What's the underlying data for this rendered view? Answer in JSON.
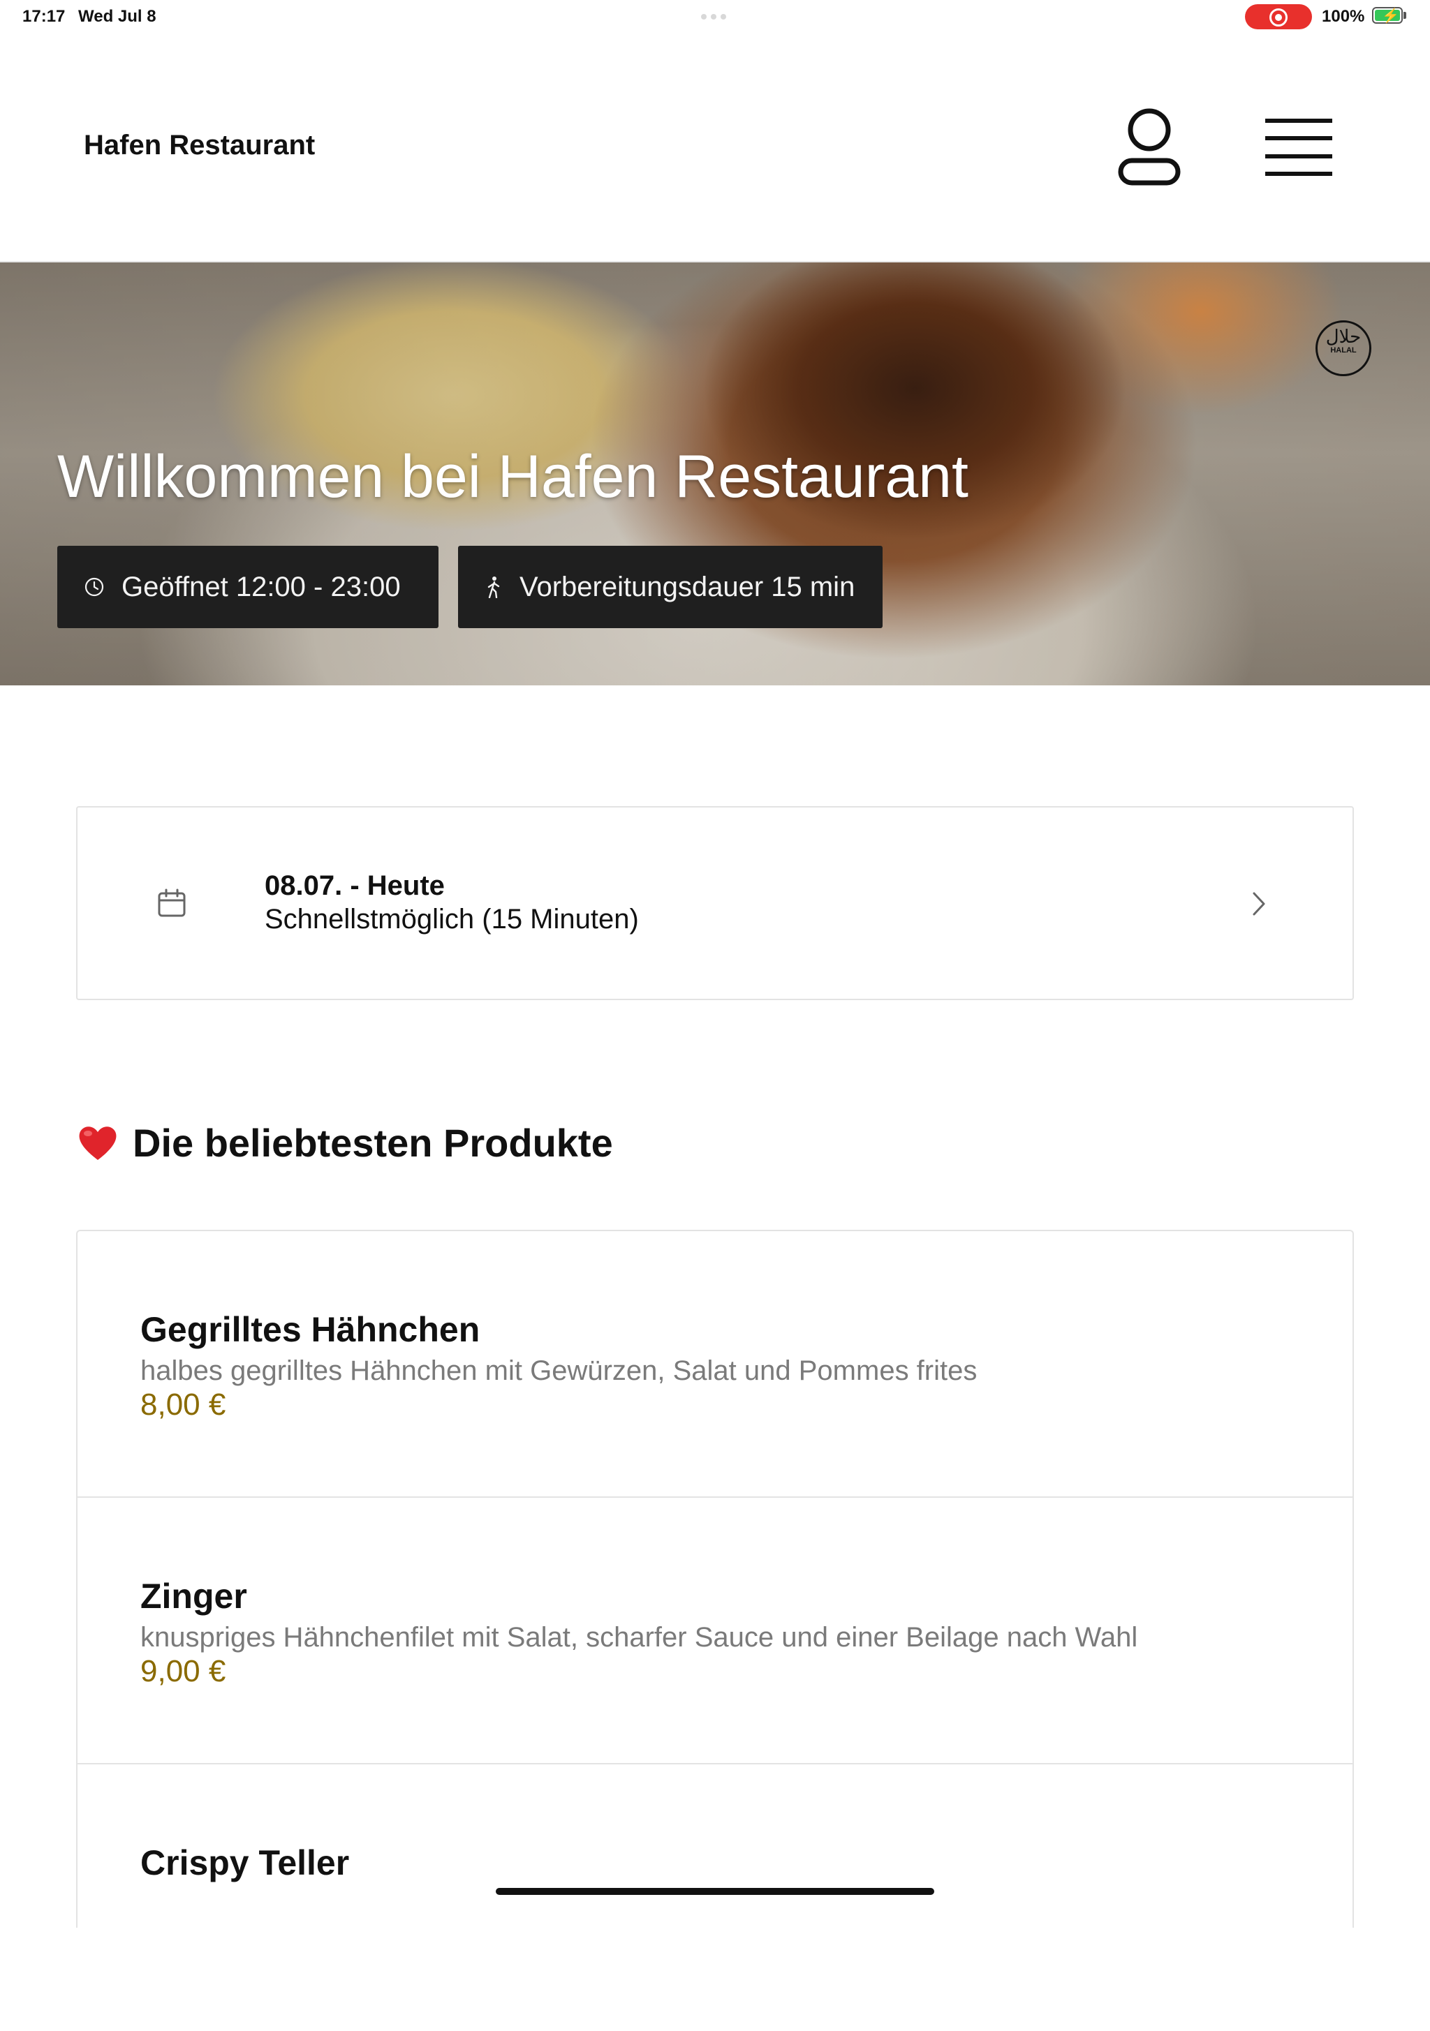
{
  "status_bar": {
    "time": "17:17",
    "date": "Wed Jul 8",
    "battery": "100%"
  },
  "header": {
    "brand": "Hafen Restaurant"
  },
  "hero": {
    "halal_label": "HALAL",
    "halal_arabic": "حلال",
    "welcome": "Willkommen bei Hafen Restaurant",
    "opening_hours": "Geöffnet 12:00 - 23:00",
    "prep_time": "Vorbereitungsdauer 15 min"
  },
  "pickup": {
    "date": "08.07. - Heute",
    "time": "Schnellstmöglich (15 Minuten)"
  },
  "popular": {
    "heading": "Die beliebtesten Produkte",
    "products": [
      {
        "name": "Gegrilltes Hähnchen",
        "description": "halbes gegrilltes Hähnchen mit Gewürzen, Salat und Pommes frites",
        "price": "8,00 €"
      },
      {
        "name": "Zinger",
        "description": "knuspriges Hähnchenfilet mit Salat, scharfer Sauce und einer Beilage nach Wahl",
        "price": "9,00 €"
      },
      {
        "name": "Crispy Teller",
        "description": "",
        "price": ""
      }
    ]
  },
  "colors": {
    "price": "#8a6a00",
    "badge_bg": "#1f1f1f",
    "record": "#e8302c",
    "battery": "#35c759"
  }
}
